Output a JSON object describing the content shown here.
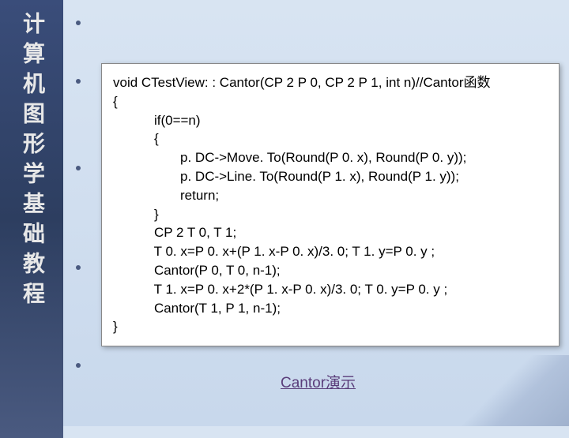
{
  "sidebar": {
    "title": "计算机图形学基础教程"
  },
  "code": {
    "line1": "void CTestView: : Cantor(CP 2 P 0, CP 2 P 1, int n)//Cantor函数",
    "line2": "{",
    "line3": "           if(0==n)",
    "line4": "           {",
    "line5": "                  p. DC->Move. To(Round(P 0. x), Round(P 0. y));",
    "line6": "                  p. DC->Line. To(Round(P 1. x), Round(P 1. y));",
    "line7": "                  return;",
    "line8": "           }",
    "line9": "           CP 2 T 0, T 1;",
    "line10": "           T 0. x=P 0. x+(P 1. x-P 0. x)/3. 0; T 1. y=P 0. y ;",
    "line11": "           Cantor(P 0, T 0, n-1);",
    "line12": "           T 1. x=P 0. x+2*(P 1. x-P 0. x)/3. 0; T 0. y=P 0. y ;",
    "line13": "           Cantor(T 1, P 1, n-1);",
    "line14": "}"
  },
  "link": {
    "label": "Cantor演示"
  }
}
